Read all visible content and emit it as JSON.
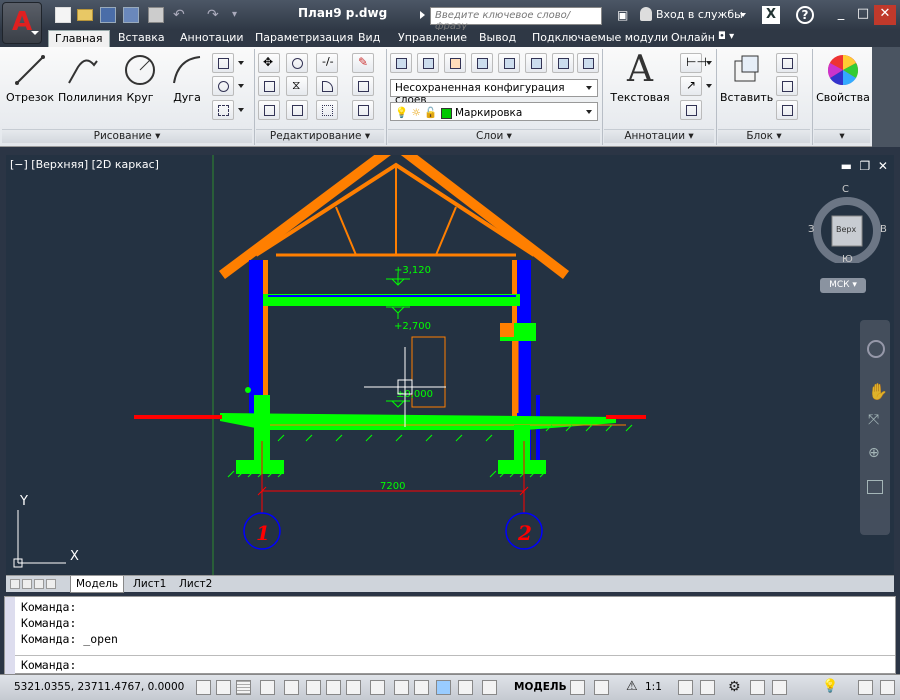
{
  "titlebar": {
    "app_letter": "A",
    "doc_title": "План9 p.dwg",
    "search_placeholder": "Введите ключевое слово/фразу",
    "login_label": "Вход в службы",
    "exchange_letter": "X",
    "help_label": "?",
    "window_buttons": [
      "_",
      "□",
      "✕"
    ]
  },
  "ribbon_tabs": [
    "Главная",
    "Вставка",
    "Аннотации",
    "Параметризация",
    "Вид",
    "Управление",
    "Вывод",
    "Подключаемые модули",
    "Онлайн"
  ],
  "ribbon": {
    "draw": {
      "title": "Рисование",
      "tools": [
        "Отрезок",
        "Полилиния",
        "Круг",
        "Дуга"
      ]
    },
    "modify": {
      "title": "Редактирование"
    },
    "layers": {
      "title": "Слои",
      "state_combo": "Несохраненная конфигурация слоев",
      "current_layer": "Маркировка",
      "current_layer_color": "#00c800"
    },
    "annotation": {
      "title": "Аннотации",
      "text_tool": "Текстовая"
    },
    "block": {
      "title": "Блок",
      "insert_tool": "Вставить"
    },
    "properties": {
      "tool": "Свойства"
    }
  },
  "viewport": {
    "controls": "[−] [Верхняя] [2D каркас]",
    "viewcube": {
      "north": "С",
      "south": "Ю",
      "west": "З",
      "east": "В",
      "face": "Верх",
      "ucs": "МСК"
    },
    "drawing": {
      "elevation_top": "+3,120",
      "elevation_mid": "+2,700",
      "elevation_low": "±0,000",
      "dimension": "7200",
      "axis_1": "1",
      "axis_2": "2",
      "ucs_y": "Y",
      "ucs_x": "X"
    }
  },
  "layout_tabs": [
    "Модель",
    "Лист1",
    "Лист2"
  ],
  "command_history": [
    "Команда:",
    "Команда:",
    "Команда: _open"
  ],
  "command_prompt": "Команда:",
  "statusbar": {
    "coords": "5321.0355, 23711.4767, 0.0000",
    "model_label": "МОДЕЛЬ",
    "scale_label": "1:1"
  },
  "colors": {
    "roof": "#ff7f00",
    "walls": "#0000ff",
    "slab": "#00ff00",
    "ground": "#ff0000",
    "axis_circle": "#0000ff",
    "axis_text": "#ff0000"
  }
}
